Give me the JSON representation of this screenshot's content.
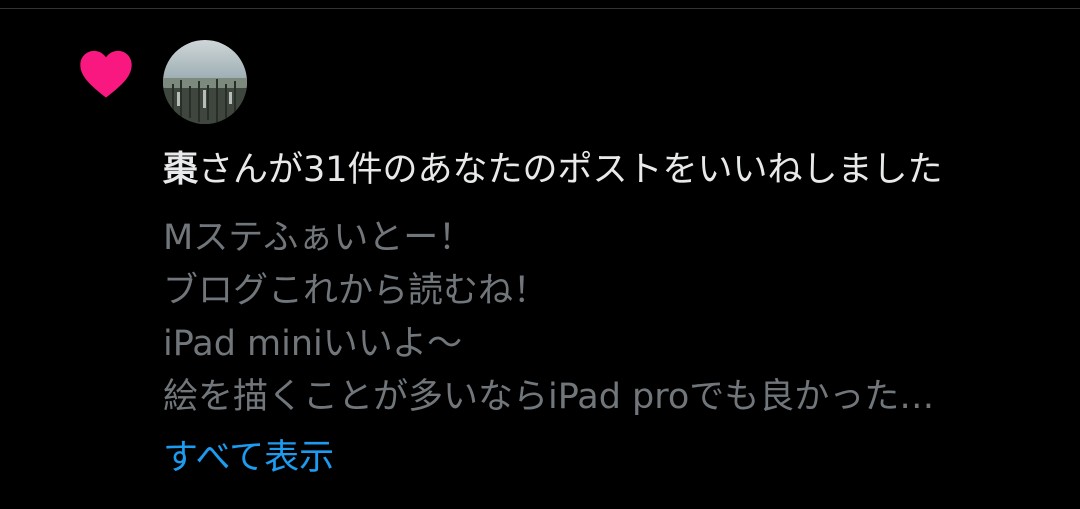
{
  "notification": {
    "icon": "heart-icon",
    "icon_color": "#f91880",
    "avatar": "user-avatar",
    "user_name": "棗",
    "action_text": "さんが31件のあなたのポストをいいねしました",
    "post_lines": [
      "Mステふぁいとー！",
      "ブログこれから読むね！",
      "iPad miniいいよ〜",
      "絵を描くことが多いならiPad proでも良かった…"
    ],
    "show_more_label": "すべて表示",
    "colors": {
      "background": "#000000",
      "primary_text": "#e7e9ea",
      "secondary_text": "#71767b",
      "link": "#1d9bf0"
    }
  }
}
